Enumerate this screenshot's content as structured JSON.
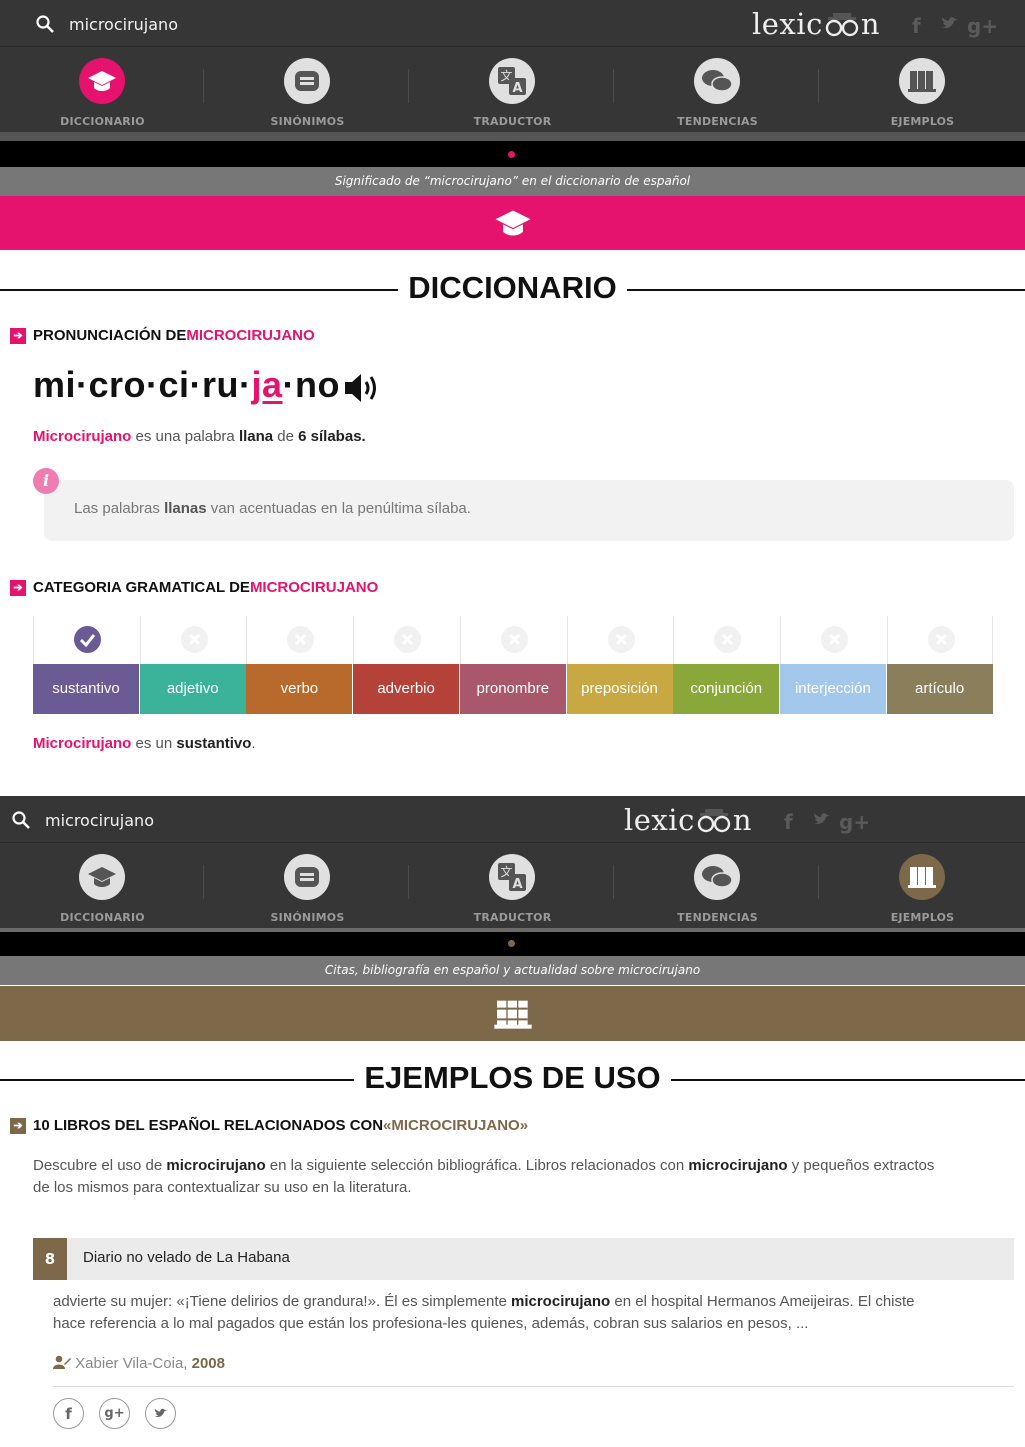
{
  "search": {
    "value": "microcirujano"
  },
  "logo": {
    "text_a": "lexic",
    "text_b": "n"
  },
  "social": {
    "facebook": "f",
    "twitter": "t",
    "gplus": "g+"
  },
  "nav": [
    {
      "label": "DICCIONARIO"
    },
    {
      "label": "SINÓNIMOS"
    },
    {
      "label": "TRADUCTOR"
    },
    {
      "label": "TENDENCIAS"
    },
    {
      "label": "EJEMPLOS"
    }
  ],
  "colors": {
    "pink": "#e5126e",
    "brown": "#7d6849",
    "dark": "#363636"
  },
  "dict": {
    "subtitle": "Significado de “microcirujano” en el diccionario de español",
    "title": "DICCIONARIO",
    "pron_heading": "PRONUNCIACIÓN DE ",
    "pron_word": "MICROCIRUJANO",
    "syll_a": "mi·cro·ci·ru·",
    "syll_b": "ja",
    "syll_c": "·no",
    "sentence": {
      "word": "Microcirujano",
      "a": " es una palabra ",
      "llana": "llana",
      "b": " de ",
      "syl": "6 sílabas",
      "c": "."
    },
    "info": {
      "a": "Las palabras ",
      "b": "llanas",
      "c": " van acentuadas en la penúltima sílaba."
    },
    "cat_heading": "CATEGORIA GRAMATICAL DE ",
    "cat_word": "MICROCIRUJANO",
    "categories": [
      {
        "label": "sustantivo",
        "color": "#6b5b95",
        "active": true
      },
      {
        "label": "adjetivo",
        "color": "#3bb39b",
        "active": false
      },
      {
        "label": "verbo",
        "color": "#b86a2c",
        "active": false
      },
      {
        "label": "adverbio",
        "color": "#b54238",
        "active": false
      },
      {
        "label": "pronombre",
        "color": "#a8586a",
        "active": false
      },
      {
        "label": "preposición",
        "color": "#c8a842",
        "active": false
      },
      {
        "label": "conjunción",
        "color": "#8aa83a",
        "active": false
      },
      {
        "label": "interjección",
        "color": "#a3c8ec",
        "active": false
      },
      {
        "label": "artículo",
        "color": "#8b7e5a",
        "active": false
      }
    ],
    "cat_sentence": {
      "word": "Microcirujano",
      "a": " es un ",
      "b": "sustantivo",
      "c": "."
    }
  },
  "examples": {
    "subtitle": "Citas, bibliografía en español y actualidad sobre microcirujano",
    "title": "EJEMPLOS DE USO",
    "books_heading": "10 LIBROS DEL ESPAÑOL RELACIONADOS CON ",
    "books_word": "«MICROCIRUJANO»",
    "intro": {
      "a": "Descubre el uso de ",
      "w1": "microcirujano",
      "b": " en la siguiente selección bibliográfica. Libros relacionados con ",
      "w2": "microcirujano",
      "c": " y pequeños extractos",
      "d": "de los mismos para contextualizar su uso en la literatura."
    },
    "book": {
      "number": "8",
      "title": "Diario no velado de La Habana",
      "ex_a": "advierte su mujer: «¡Tiene delirios de grandura!». Él es simplemente ",
      "ex_w": "microcirujano",
      "ex_b": " en el hospital Hermanos Ameijeiras. El chiste",
      "ex_c": "hace referencia a lo mal pagados que están los profesiona-les quienes, además, cobran sus salarios en pesos, ...",
      "author": "Xabier Vila-Coia, ",
      "year": "2008"
    }
  }
}
